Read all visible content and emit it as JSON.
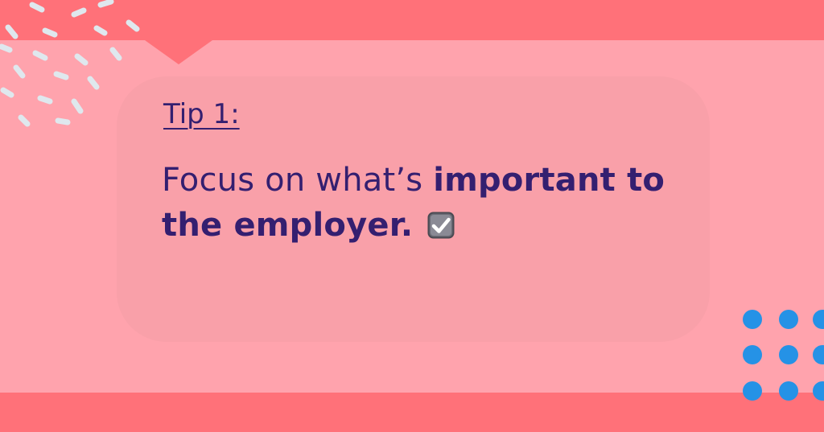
{
  "tip": {
    "label": "Tip 1:",
    "headline_regular": "Focus on what’s ",
    "headline_bold": "important to the employer.",
    "icon": "checked-box-icon"
  },
  "colors": {
    "background": "#ffa3ad",
    "bands": "#ff7179",
    "card": "#f9a0a9",
    "text": "#341f70",
    "dash_decoration": "#dfe8ee",
    "dots": "#2592e6"
  }
}
